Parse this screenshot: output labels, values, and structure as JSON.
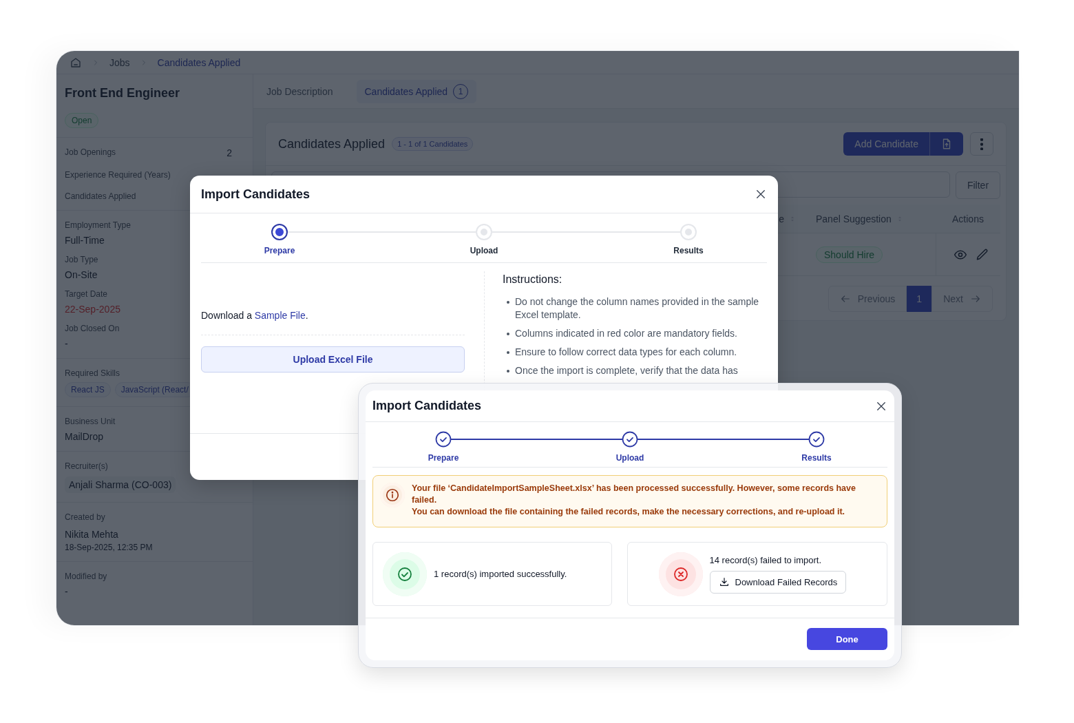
{
  "breadcrumb": [
    {
      "label": "Jobs",
      "selected": false
    },
    {
      "label": "Candidates Applied",
      "selected": true
    }
  ],
  "job": {
    "title": "Front End Engineer",
    "status": "Open"
  },
  "stats": [
    {
      "label": "Job Openings",
      "value": "2"
    },
    {
      "label": "Experience Required (Years)"
    },
    {
      "label": "Candidates Applied"
    }
  ],
  "details": [
    {
      "label": "Employment Type",
      "value": "Full-Time",
      "kind": "plain"
    },
    {
      "label": "Job Type",
      "value": "On-Site",
      "kind": "plain"
    },
    {
      "label": "Target Date",
      "value": "22-Sep-2025",
      "kind": "alert"
    },
    {
      "label": "Job Closed On",
      "value": "-",
      "kind": "plain"
    }
  ],
  "skills": {
    "label": "Required Skills",
    "items": [
      "React JS",
      "JavaScript (React/"
    ]
  },
  "business_unit": {
    "label": "Business Unit",
    "value": "MailDrop"
  },
  "recruiters": {
    "label": "Recruiter(s)",
    "items": [
      "Anjali Sharma (CO-003)"
    ]
  },
  "created": {
    "label": "Created by",
    "name": "Nikita Mehta",
    "time": "18-Sep-2025, 12:35 PM"
  },
  "modified": {
    "label": "Modified by",
    "value": "-"
  },
  "tabs": [
    {
      "label": "Job Description",
      "selected": false
    },
    {
      "label": "Candidates Applied",
      "count": "1",
      "selected": true
    }
  ],
  "candidates": {
    "title": "Candidates Applied",
    "range": "1 - 1 of 1 Candidates",
    "add_button": "Add Candidate",
    "filter_button": "Filter",
    "columns": [
      {
        "label": "e",
        "sortable": true
      },
      {
        "label": "Panel Suggestion",
        "sortable": true
      },
      {
        "label": "Actions",
        "sortable": false
      }
    ],
    "rows": [
      {
        "panel_suggestion": "Should Hire"
      }
    ],
    "pagination": {
      "previous": "Previous",
      "pages": [
        {
          "label": "1",
          "selected": true
        }
      ],
      "next": "Next"
    }
  },
  "import_dialog": {
    "title": "Import Candidates",
    "steps": [
      {
        "label": "Prepare",
        "kind": "current"
      },
      {
        "label": "Upload",
        "kind": "pending"
      },
      {
        "label": "Results",
        "kind": "pending"
      }
    ],
    "download_text": "Download a ",
    "sample_link": "Sample File",
    "download_end": ".",
    "upload_button": "Upload Excel File",
    "instructions_title": "Instructions:",
    "instructions": [
      "Do not change the column names provided in the sample Excel template.",
      "Columns indicated in red color are mandatory fields.",
      "Ensure to follow correct data types for each column.",
      "Once the import is complete, verify that the data has"
    ]
  },
  "results_dialog": {
    "title": "Import Candidates",
    "steps": [
      {
        "label": "Prepare",
        "kind": "done"
      },
      {
        "label": "Upload",
        "kind": "done"
      },
      {
        "label": "Results",
        "kind": "done"
      }
    ],
    "alert": [
      "Your file ‘CandidateImportSampleSheet.xlsx’ has been processed successfully. However, some records have failed.",
      "You can download the file containing the failed records, make the necessary corrections, and re-upload it."
    ],
    "results": [
      {
        "kind": "success",
        "text": "1 record(s) imported successfully."
      },
      {
        "kind": "failed",
        "text": "14 record(s) failed to import.",
        "button": "Download Failed Records"
      }
    ],
    "done_button": "Done"
  }
}
